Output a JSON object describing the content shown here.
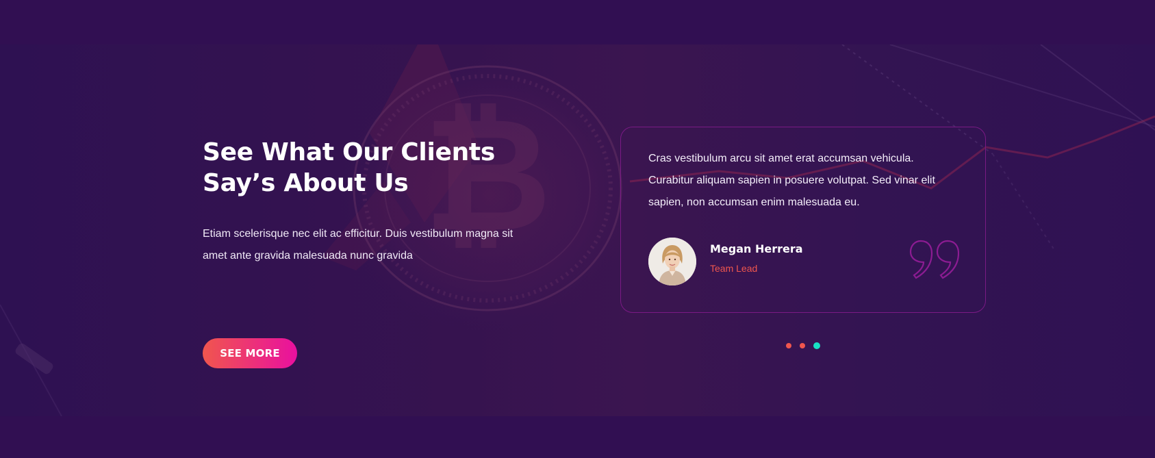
{
  "testimonials": {
    "heading_line1": "See What Our Clients",
    "heading_line2": "Say’s About Us",
    "intro_line1": "Etiam scelerisque nec elit ac efficitur. Duis vestibulum magna sit",
    "intro_line2": "amet ante gravida malesuada nunc gravida",
    "cta_label": "SEE MORE"
  },
  "quote": {
    "line1": "Cras vestibulum arcu sit amet erat accumsan vehicula.",
    "line2": "Curabitur aliquam sapien in posuere volutpat. Sed vinar elit",
    "line3": "sapien, non accumsan enim malesuada eu.",
    "author_name": "Megan Herrera",
    "author_role": "Team Lead",
    "avatar_icon": "woman-portrait",
    "quote_icon": "closing-quote-icon"
  },
  "slider": {
    "dots": [
      "inactive",
      "inactive",
      "active"
    ],
    "active_index": 2
  },
  "colors": {
    "page_background": "#310f52",
    "accent_coral": "#f0564e",
    "accent_magenta": "#e9109f",
    "active_dot": "#18e0c4",
    "card_border": "#7b1a85"
  }
}
